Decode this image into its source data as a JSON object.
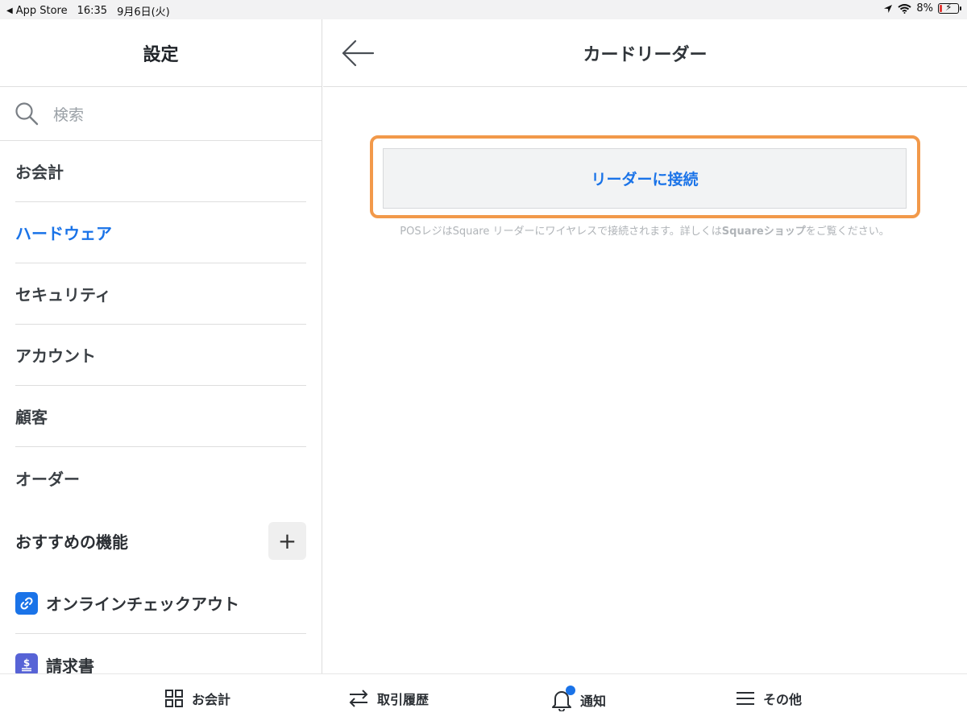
{
  "status_bar": {
    "back_app": "App Store",
    "time": "16:35",
    "date": "9月6日(火)",
    "battery": "8%",
    "icons": [
      "location-arrow-icon",
      "wifi-icon",
      "battery-charging-icon"
    ]
  },
  "sidebar": {
    "title": "設定",
    "search": {
      "placeholder": "検索",
      "icon": "search-icon"
    },
    "items": [
      {
        "label": "お会計",
        "active": false
      },
      {
        "label": "ハードウェア",
        "active": true
      },
      {
        "label": "セキュリティ",
        "active": false
      },
      {
        "label": "アカウント",
        "active": false
      },
      {
        "label": "顧客",
        "active": false
      },
      {
        "label": "オーダー",
        "active": false
      }
    ],
    "recommended": {
      "title": "おすすめの機能",
      "add_label": "+",
      "items": [
        {
          "label": "オンラインチェックアウト",
          "icon": "link-icon"
        },
        {
          "label": "請求書",
          "icon": "dollar-invoice-icon"
        }
      ]
    }
  },
  "main": {
    "title": "カードリーダー",
    "back_icon": "arrow-left-icon",
    "connect_button": "リーダーに接続",
    "helper_text_1": "POSレジはSquare リーダーにワイヤレスで接続されます。詳しくは",
    "helper_link": "Squareショップ",
    "helper_text_2": "をご覧ください。"
  },
  "tabbar": {
    "tabs": [
      {
        "label": "お会計",
        "icon": "grid-icon"
      },
      {
        "label": "取引履歴",
        "icon": "swap-arrows-icon"
      },
      {
        "label": "通知",
        "icon": "bell-icon",
        "has_badge": true
      },
      {
        "label": "その他",
        "icon": "menu-icon"
      }
    ]
  },
  "colors": {
    "accent": "#1a73e8",
    "highlight": "#f2994a",
    "battery_low": "#e53935"
  }
}
